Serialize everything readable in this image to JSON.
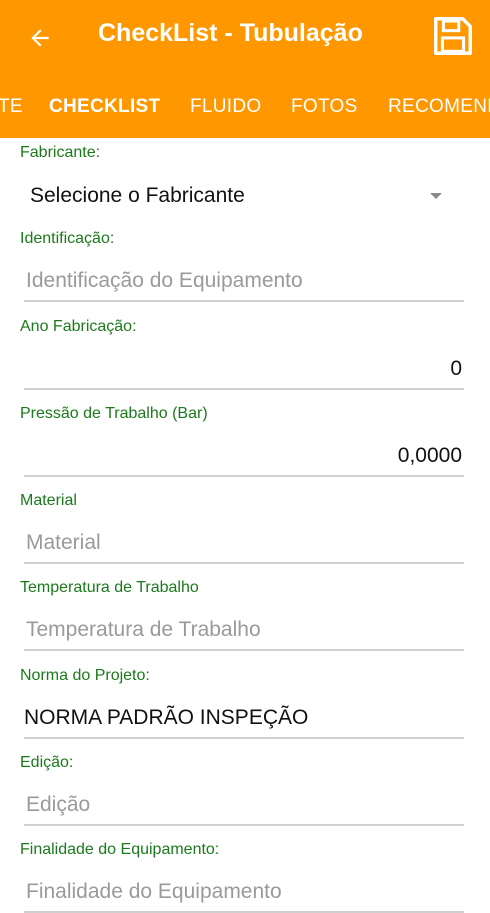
{
  "appbar": {
    "title": "CheckList - Tubulação",
    "back_icon": "arrow-left-icon",
    "save_icon": "floppy-disk-icon",
    "color": "#FF9800"
  },
  "tabs": [
    {
      "label": "TE"
    },
    {
      "label": "CHECKLIST",
      "active": true
    },
    {
      "label": "FLUIDO"
    },
    {
      "label": "FOTOS"
    },
    {
      "label": "RECOMEND"
    }
  ],
  "form": {
    "fabricante": {
      "label": "Fabricante:",
      "value": "Selecione o Fabricante"
    },
    "identificacao": {
      "label": "Identificação:",
      "placeholder": "Identificação do Equipamento"
    },
    "ano": {
      "label": "Ano Fabricação:",
      "value": "0"
    },
    "pressao": {
      "label": "Pressão de Trabalho (Bar)",
      "value": "0,0000"
    },
    "material": {
      "label": "Material",
      "placeholder": "Material"
    },
    "temperatura": {
      "label": "Temperatura de Trabalho",
      "placeholder": "Temperatura de Trabalho"
    },
    "norma": {
      "label": "Norma do Projeto:",
      "value": "NORMA PADRÃO INSPEÇÃO"
    },
    "edicao": {
      "label": "Edição:",
      "placeholder": "Edição"
    },
    "finalidade": {
      "label": "Finalidade do Equipamento:",
      "placeholder": "Finalidade do Equipamento"
    }
  },
  "colors": {
    "label": "#1B7A1B",
    "underline": "#cfcfcf"
  }
}
